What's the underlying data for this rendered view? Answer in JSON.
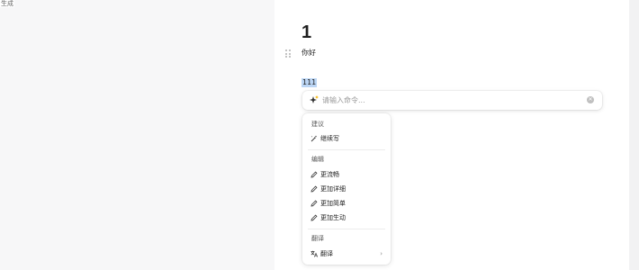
{
  "corner": {
    "text": "生成"
  },
  "document": {
    "title": "1",
    "paragraph": "你好",
    "selected_text": "111"
  },
  "ai_bar": {
    "placeholder": "请输入命令...",
    "value": ""
  },
  "ai_menu": {
    "sections": [
      {
        "title": "建议",
        "items": [
          {
            "label": "继续写",
            "icon": "pen-sparkle-icon"
          }
        ]
      },
      {
        "title": "编辑",
        "items": [
          {
            "label": "更流畅",
            "icon": "pencil-icon"
          },
          {
            "label": "更加详细",
            "icon": "pencil-icon"
          },
          {
            "label": "更加简单",
            "icon": "pencil-icon"
          },
          {
            "label": "更加生动",
            "icon": "pencil-icon"
          }
        ]
      },
      {
        "title": "翻译",
        "items": [
          {
            "label": "翻译",
            "icon": "translate-icon",
            "has_submenu": true
          }
        ]
      }
    ]
  },
  "colors": {
    "selection": "#bcd6f5",
    "sparkle_accent": "#f5b400"
  }
}
